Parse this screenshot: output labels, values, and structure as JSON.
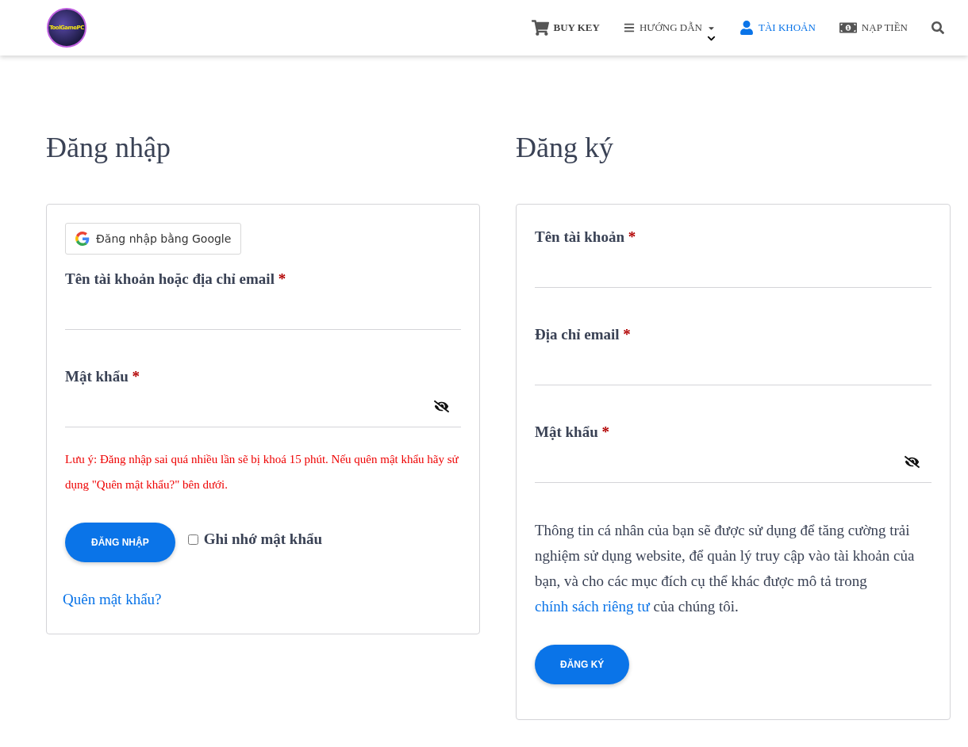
{
  "header": {
    "logo_text": "ToolGamePC",
    "nav": [
      {
        "kind": "cart",
        "label": "BUY KEY",
        "selected": false,
        "bold": true
      },
      {
        "kind": "menu",
        "label": "HƯỚNG DẪN",
        "selected": false,
        "dropdown": true
      },
      {
        "kind": "user",
        "label": "TÀI KHOẢN",
        "selected": true
      },
      {
        "kind": "money",
        "label": "NẠP TIỀN",
        "selected": false
      },
      {
        "kind": "search",
        "selected": false
      }
    ]
  },
  "login": {
    "title": "Đăng nhập",
    "google_button": "Đăng nhập bằng Google",
    "fields": [
      {
        "kind": "text",
        "label": "Tên tài khoản hoặc địa chỉ email",
        "required": "*"
      },
      {
        "kind": "password",
        "label": "Mật khẩu",
        "required": "*"
      }
    ],
    "note": "Lưu ý: Đăng nhập sai quá nhiều lần sẽ bị khoá 15 phút. Nếu quên mật khẩu hãy sử dụng \"Quên mật khẩu?\" bên dưới.",
    "submit": "ĐĂNG NHẬP",
    "remember": {
      "label": "Ghi nhớ mật khẩu",
      "checked": false
    },
    "forgot": "Quên mật khẩu?"
  },
  "register": {
    "title": "Đăng ký",
    "fields": [
      {
        "kind": "text",
        "label": "Tên tài khoản",
        "required": "*"
      },
      {
        "kind": "text",
        "label": "Địa chỉ email",
        "required": "*"
      },
      {
        "kind": "password",
        "label": "Mật khẩu",
        "required": "*"
      }
    ],
    "privacy": {
      "before": "Thông tin cá nhân của bạn sẽ được sử dụng để tăng cường trải nghiệm sử dụng website, để quản lý truy cập vào tài khoản của bạn, và cho các mục đích cụ thể khác được mô tả trong",
      "link": "chính sách riêng tư",
      "after": "của chúng tôi."
    },
    "submit": "ĐĂNG KÝ"
  }
}
